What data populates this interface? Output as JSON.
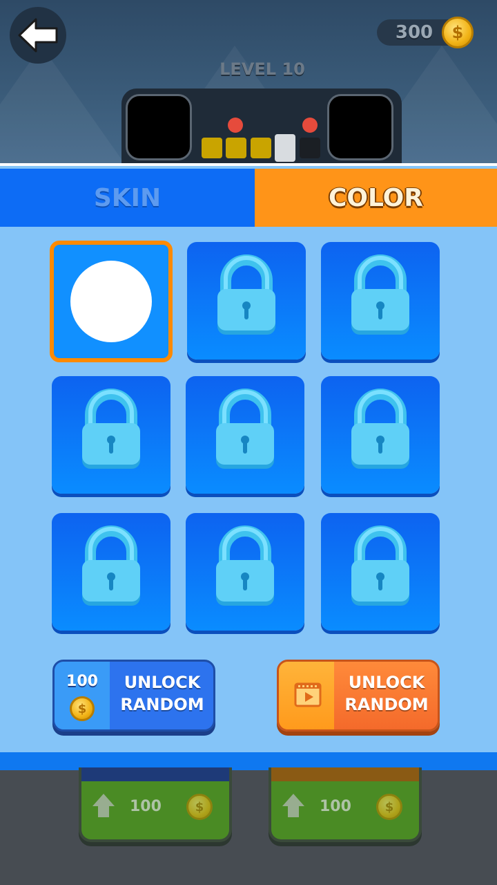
{
  "header": {
    "coins": "300",
    "coin_symbol": "$",
    "level": "LEVEL 10",
    "progress": {
      "filled": 3,
      "current": 1,
      "total": 5
    }
  },
  "tabs": [
    {
      "label": "SKIN",
      "active": false
    },
    {
      "label": "COLOR",
      "active": true
    }
  ],
  "grid": {
    "items": [
      {
        "state": "selected",
        "color": "#ffffff"
      },
      {
        "state": "locked"
      },
      {
        "state": "locked"
      },
      {
        "state": "locked"
      },
      {
        "state": "locked"
      },
      {
        "state": "locked"
      },
      {
        "state": "locked"
      },
      {
        "state": "locked"
      },
      {
        "state": "locked"
      }
    ]
  },
  "actions": {
    "coin_unlock": {
      "price": "100",
      "coin_symbol": "$",
      "label_line1": "UNLOCK",
      "label_line2": "RANDOM"
    },
    "ad_unlock": {
      "icon": "video-ad-icon",
      "label_line1": "UNLOCK",
      "label_line2": "RANDOM"
    }
  },
  "upgrades": [
    {
      "price": "100",
      "coin_symbol": "$",
      "color": "#4a8b24"
    },
    {
      "price": "100",
      "coin_symbol": "$",
      "color": "#4a8b24"
    }
  ],
  "colors": {
    "accent_orange": "#ff9418",
    "tab_blue": "#0d6cf5",
    "panel_blue": "#84c4f8"
  }
}
